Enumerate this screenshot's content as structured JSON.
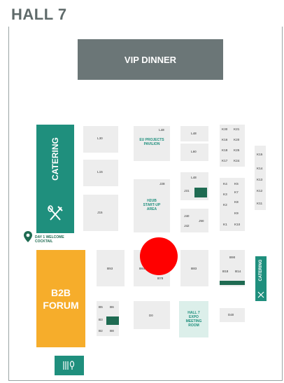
{
  "title": "HALL 7",
  "areas": {
    "vip_dinner": "VIP DINNER",
    "catering_left": "CATERING",
    "catering_right": "CATERING",
    "b2b_forum_line1": "B2B",
    "b2b_forum_line2": "FORUM",
    "welcome_cocktail_line1": "DAY 1 WELCOME",
    "welcome_cocktail_line2": "COCKTAIL",
    "eu_projects_line1": "EU PROJECTS",
    "eu_projects_line2": "PAVILION",
    "h2ub_line1": "H2UB",
    "h2ub_line2": "START-UP",
    "h2ub_line3": "AREA",
    "expo_line1": "HALL 7",
    "expo_line2": "EXPO",
    "expo_line3": "MEETING",
    "expo_line4": "ROOM"
  },
  "booths": {
    "l30": "L30",
    "l15": "L15",
    "j15": "J15",
    "l48_top": "L48",
    "l48": "L48",
    "l60": "L60",
    "k30": "K30",
    "k21": "K21",
    "k16": "K16",
    "k20": "K20",
    "k18": "K18",
    "k25": "K25",
    "k17": "K17",
    "k24": "K24",
    "j28": "J28",
    "j31": "J31",
    "j40": "J40",
    "j42": "J42",
    "j50": "J50",
    "k4": "K4",
    "k5": "K5",
    "k7": "K7",
    "k3": "K3",
    "k8": "K8",
    "k2": "K2",
    "k9": "K9",
    "k1": "K1",
    "k10": "K10",
    "k15": "K15",
    "k14": "K14",
    "k13": "K13",
    "k12": "K12",
    "k11": "K11",
    "b53": "B53",
    "b64": "B64",
    "b78": "B78",
    "b83": "B83",
    "b90": "B90",
    "b18": "B18",
    "b14": "B14",
    "b5": "B5",
    "b6": "B6",
    "b3": "B3",
    "b2": "B2",
    "b1": "B1",
    "b8": "B8",
    "d0": "D0",
    "d40": "D40",
    "l48_eu": "L48"
  },
  "colors": {
    "teal": "#1f8f7d",
    "orange": "#f6ad2b",
    "vip_grey": "#6b7677",
    "booth_grey": "#ededed",
    "marker": "#ff0000"
  }
}
